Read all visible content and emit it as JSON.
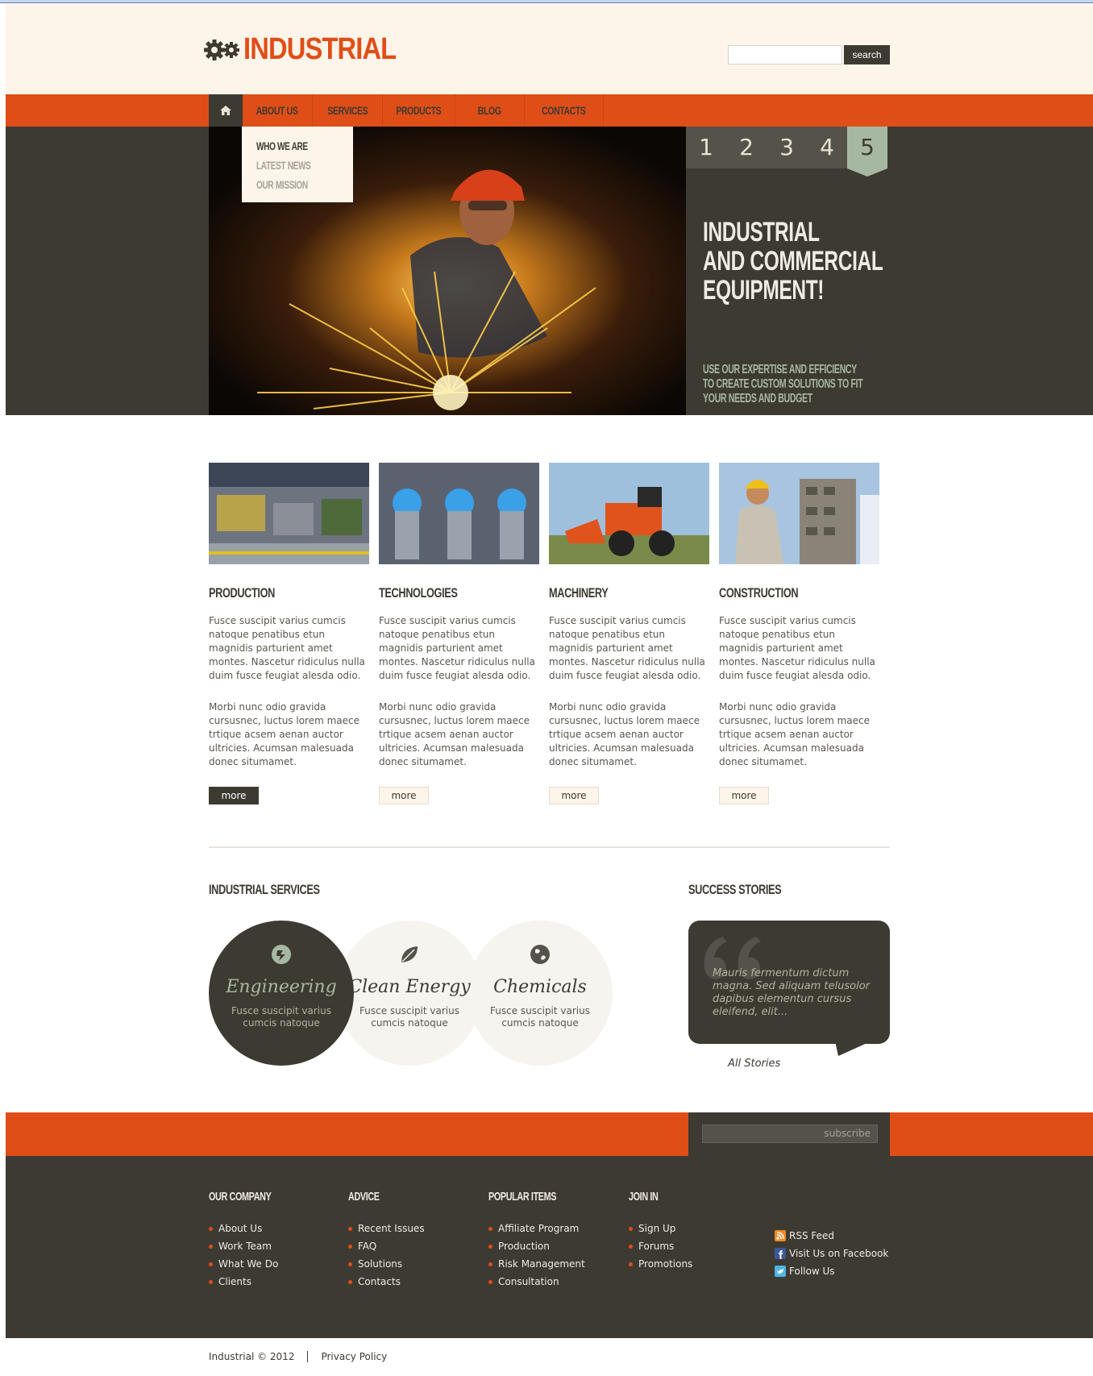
{
  "brand": {
    "logo_text": "INDUSTRIAL",
    "accent": "#e04e17",
    "dark": "#3d3a32",
    "cream": "#fdf4ea"
  },
  "search": {
    "button_label": "search",
    "placeholder": ""
  },
  "nav": {
    "home_icon": "home-icon",
    "items": [
      "ABOUT US",
      "SERVICES",
      "PRODUCTS",
      "BLOG",
      "CONTACTS"
    ],
    "dropdown": [
      "WHO WE ARE",
      "LATEST NEWS",
      "OUR MISSION"
    ]
  },
  "hero": {
    "slide_tabs": [
      "1",
      "2",
      "3",
      "4",
      "5"
    ],
    "active_slide": "5",
    "title_lines": [
      "INDUSTRIAL",
      "AND COMMERCIAL",
      "EQUIPMENT!"
    ],
    "subtitle_lines": [
      "USE OUR EXPERTISE AND EFFICIENCY",
      "TO CREATE CUSTOM SOLUTIONS TO FIT",
      "YOUR NEEDS AND BUDGET"
    ]
  },
  "features": [
    {
      "title": "PRODUCTION",
      "p1": "Fusce suscipit varius cumcis natoque penatibus etun magnidis parturient amet montes. Nascetur ridiculus nulla duim fusce feugiat alesda odio.",
      "p2": "Morbi nunc odio gravida cursusnec, luctus lorem maece trtique acsem aenan auctor ultricies. Acumsan malesuada donec situmamet.",
      "more": "more"
    },
    {
      "title": "TECHNOLOGIES",
      "p1": "Fusce suscipit varius cumcis natoque penatibus etun magnidis parturient amet montes. Nascetur ridiculus nulla duim fusce feugiat alesda odio.",
      "p2": "Morbi nunc odio gravida cursusnec, luctus lorem maece trtique acsem aenan auctor ultricies. Acumsan malesuada donec situmamet.",
      "more": "more"
    },
    {
      "title": "MACHINERY",
      "p1": "Fusce suscipit varius cumcis natoque penatibus etun magnidis parturient amet montes. Nascetur ridiculus nulla duim fusce feugiat alesda odio.",
      "p2": "Morbi nunc odio gravida cursusnec, luctus lorem maece trtique acsem aenan auctor ultricies. Acumsan malesuada donec situmamet.",
      "more": "more"
    },
    {
      "title": "CONSTRUCTION",
      "p1": "Fusce suscipit varius cumcis natoque penatibus etun magnidis parturient amet montes. Nascetur ridiculus nulla duim fusce feugiat alesda odio.",
      "p2": "Morbi nunc odio gravida cursusnec, luctus lorem maece trtique acsem aenan auctor ultricies. Acumsan malesuada donec situmamet.",
      "more": "more"
    }
  ],
  "services": {
    "title": "INDUSTRIAL SERVICES",
    "items": [
      {
        "title": "Engineering",
        "desc": "Fusce suscipit varius cumcis natoque",
        "icon": "gear-arrows-icon"
      },
      {
        "title": "Clean Energy",
        "desc": "Fusce suscipit varius cumcis natoque",
        "icon": "leaf-icon"
      },
      {
        "title": "Chemicals",
        "desc": "Fusce suscipit varius cumcis natoque",
        "icon": "globe-icon"
      }
    ]
  },
  "stories": {
    "title": "SUCCESS STORIES",
    "quote": "Mauris fermentum dictum magna. Sed aliquam telusolor dapibus elementun cursus eleifend, elit...",
    "link": "All Stories"
  },
  "subscribe": {
    "label": "subscribe"
  },
  "footer": {
    "columns": [
      {
        "title": "OUR COMPANY",
        "links": [
          "About Us",
          "Work Team",
          "What We Do",
          "Clients"
        ]
      },
      {
        "title": "ADVICE",
        "links": [
          "Recent Issues",
          "FAQ",
          "Solutions",
          "Contacts"
        ]
      },
      {
        "title": "POPULAR ITEMS",
        "links": [
          "Affiliate Program",
          "Production",
          "Risk Management",
          "Consultation"
        ]
      },
      {
        "title": "JOIN IN",
        "links": [
          "Sign Up",
          "Forums",
          "Promotions"
        ]
      }
    ],
    "social": [
      {
        "label": "RSS Feed",
        "icon": "rss-icon",
        "color": "#f08a24"
      },
      {
        "label": "Visit Us on Facebook",
        "icon": "facebook-icon",
        "color": "#3b5998"
      },
      {
        "label": "Follow Us",
        "icon": "twitter-icon",
        "color": "#4db5e8"
      }
    ]
  },
  "bottom": {
    "copyright": "Industrial © 2012",
    "privacy": "Privacy Policy"
  }
}
